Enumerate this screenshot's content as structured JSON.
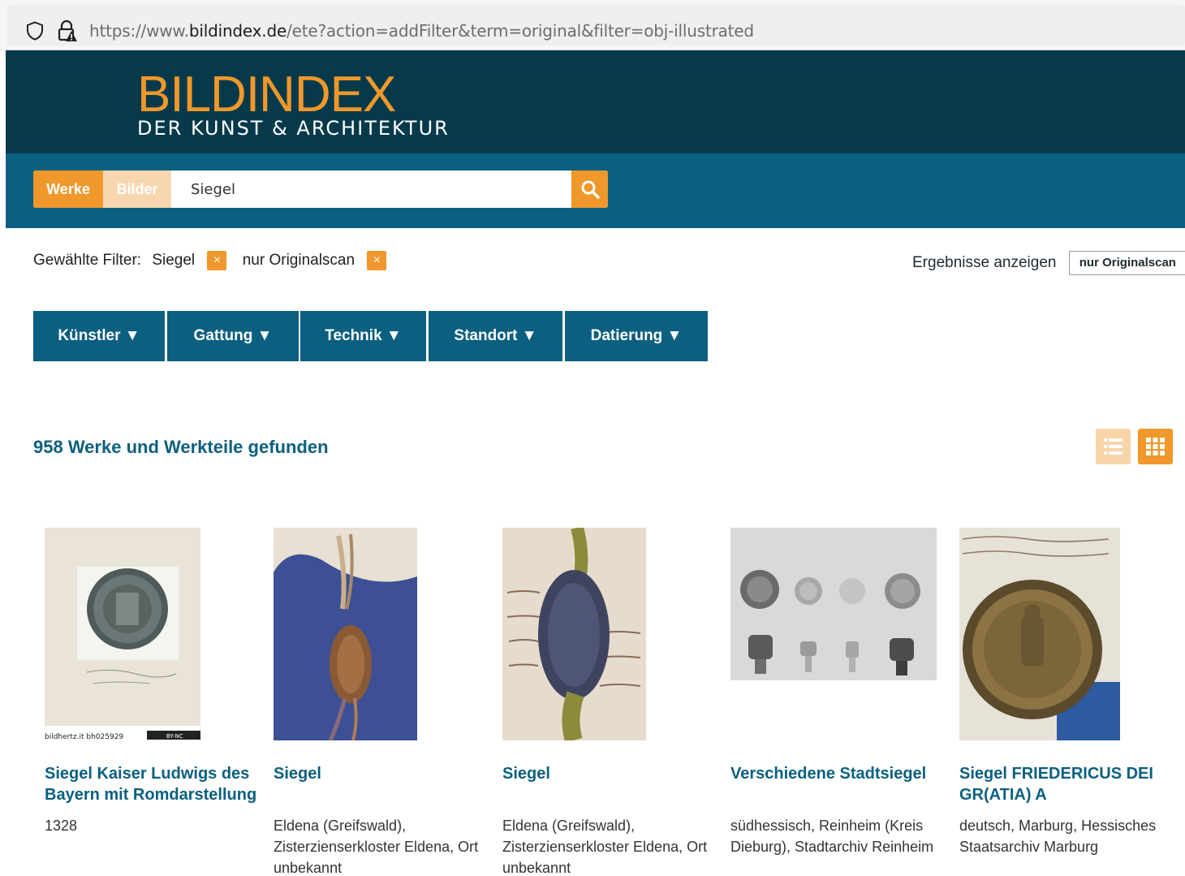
{
  "browser": {
    "url_prefix": "https://www.",
    "url_host": "bildindex.de",
    "url_path": "/ete?action=addFilter&term=original&filter=obj-illustrated"
  },
  "header": {
    "logo_main": "BILDINDEX",
    "logo_sub": "DER KUNST & ARCHITEKTUR"
  },
  "search": {
    "tab_werke": "Werke",
    "tab_bilder": "Bilder",
    "query": "Siegel",
    "button_icon": "search-icon"
  },
  "filters": {
    "label": "Gewählte Filter:",
    "active": [
      "Siegel",
      "nur Originalscan"
    ],
    "remove_glyph": "×"
  },
  "results_display": {
    "label": "Ergebnisse anzeigen",
    "selected": "nur Originalscan"
  },
  "facets": [
    "Künstler ▼",
    "Gattung ▼",
    "Technik ▼",
    "Standort ▼",
    "Datierung ▼"
  ],
  "results": {
    "count_text": "958 Werke und Werkteile gefunden",
    "views": [
      "list-view-icon",
      "grid-view-icon"
    ],
    "items": [
      {
        "title": "Siegel Kaiser Ludwigs des Bayern mit Romdarstellung",
        "meta": "1328",
        "caption": "bildhertz.it bh025929",
        "license": "BY-NC"
      },
      {
        "title": "Siegel",
        "meta": "Eldena (Greifswald), Zisterzienserkloster Eldena, Ort unbekannt"
      },
      {
        "title": "Siegel",
        "meta": "Eldena (Greifswald), Zisterzienserkloster Eldena, Ort unbekannt"
      },
      {
        "title": "Verschiedene Stadtsiegel",
        "meta": "südhessisch, Reinheim (Kreis Dieburg), Stadtarchiv Reinheim"
      },
      {
        "title": "Siegel FRIEDERICUS DEI GR(ATIA) A",
        "meta": "deutsch, Marburg, Hessisches Staatsarchiv Marburg"
      }
    ]
  },
  "colors": {
    "header_dark": "#063a4b",
    "band_blue": "#0b5f80",
    "accent_orange": "#f0982b"
  }
}
